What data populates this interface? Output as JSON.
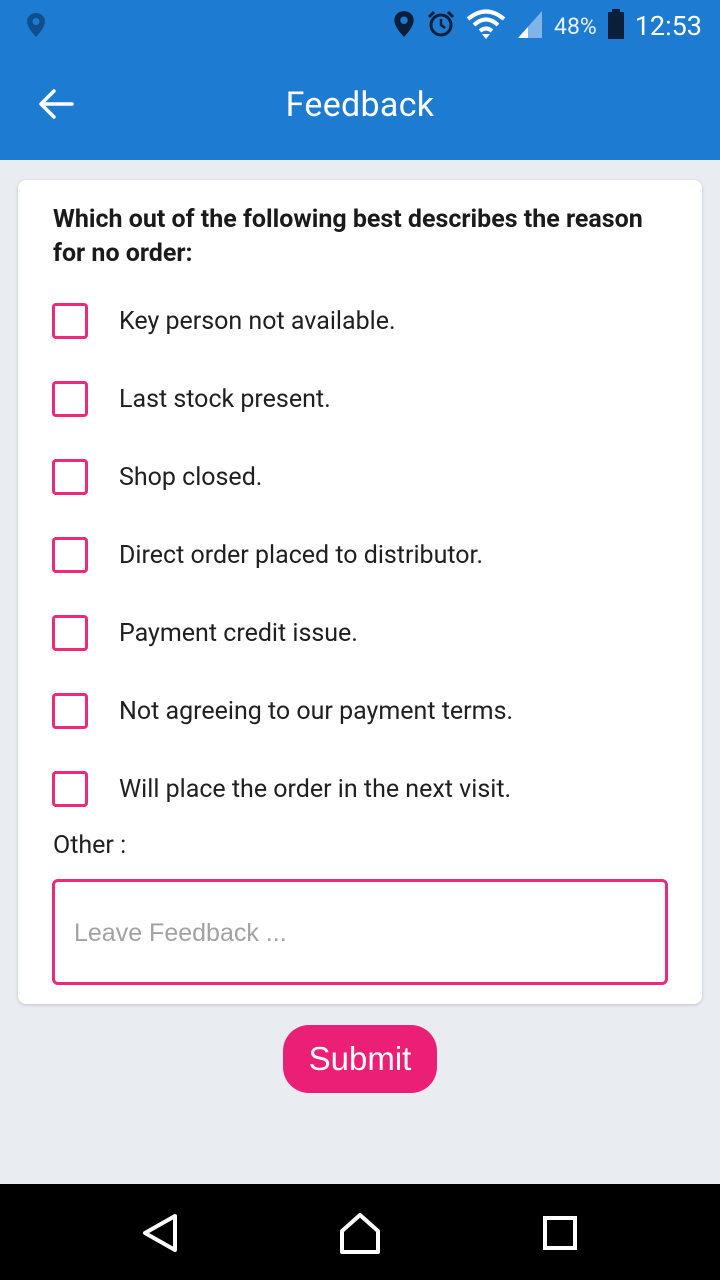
{
  "status_bar": {
    "battery_percent": "48%",
    "time": "12:53",
    "icons": [
      "location-icon",
      "alarm-icon",
      "wifi-icon",
      "signal-icon",
      "battery-icon"
    ]
  },
  "app_bar": {
    "title": "Feedback",
    "back_icon": "arrow-left-icon",
    "background": "#1e7bd2"
  },
  "form": {
    "question": "Which out of the following best describes the reason for no order:",
    "options": [
      {
        "label": "Key person not available.",
        "checked": false
      },
      {
        "label": "Last stock present.",
        "checked": false
      },
      {
        "label": "Shop closed.",
        "checked": false
      },
      {
        "label": "Direct order placed to distributor.",
        "checked": false
      },
      {
        "label": "Payment credit issue.",
        "checked": false
      },
      {
        "label": "Not agreeing to our payment terms.",
        "checked": false
      },
      {
        "label": "Will place the order in the next visit.",
        "checked": false
      }
    ],
    "other_label": "Other :",
    "feedback_value": "",
    "feedback_placeholder": "Leave Feedback ...",
    "accent_color": "#ec2a7b"
  },
  "submit": {
    "label": "Submit",
    "color": "#ec1f77"
  },
  "nav_bar": {
    "icons": [
      "back-triangle-icon",
      "home-icon",
      "recents-square-icon"
    ]
  }
}
